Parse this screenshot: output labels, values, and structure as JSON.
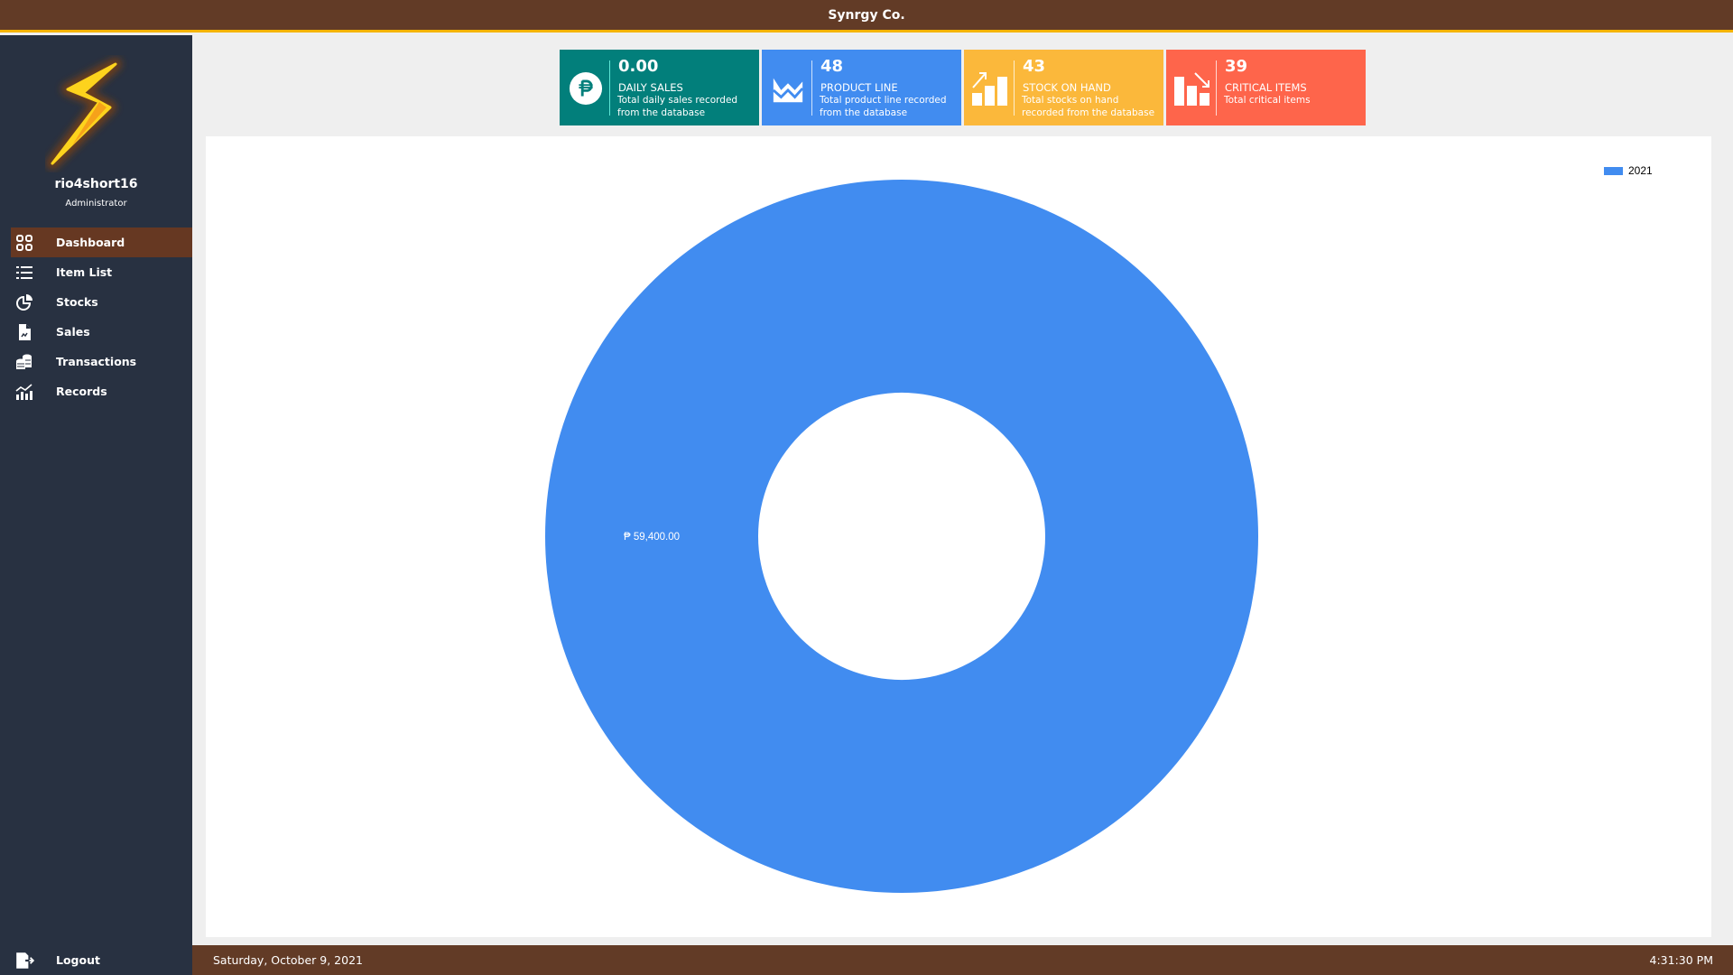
{
  "app": {
    "title": "Synrgy Co."
  },
  "user": {
    "name": "rio4short16",
    "role": "Administrator"
  },
  "sidebar": {
    "items": [
      {
        "label": "Dashboard",
        "icon": "grid-icon",
        "active": true
      },
      {
        "label": "Item List",
        "icon": "list-icon",
        "active": false
      },
      {
        "label": "Stocks",
        "icon": "pie-chart-icon",
        "active": false
      },
      {
        "label": "Sales",
        "icon": "document-chart-icon",
        "active": false
      },
      {
        "label": "Transactions",
        "icon": "coins-icon",
        "active": false
      },
      {
        "label": "Records",
        "icon": "bar-trend-icon",
        "active": false
      }
    ],
    "logout_label": "Logout"
  },
  "cards": [
    {
      "value": "0.00",
      "label": "DAILY SALES",
      "desc": "Total daily sales recorded from the database",
      "icon": "peso-icon",
      "color": "#027f7b"
    },
    {
      "value": "48",
      "label": "PRODUCT LINE",
      "desc": "Total product line recorded from the database",
      "icon": "area-chart-icon",
      "color": "#418cf0"
    },
    {
      "value": "43",
      "label": "STOCK ON HAND",
      "desc": "Total stocks on hand recorded from the database",
      "icon": "bar-chart-up-icon",
      "color": "#fbb83b"
    },
    {
      "value": "39",
      "label": "CRITICAL ITEMS",
      "desc": "Total critical items",
      "icon": "bar-chart-down-icon",
      "color": "#fe654b"
    }
  ],
  "chart_data": {
    "type": "pie",
    "variant": "doughnut",
    "title": "",
    "categories": [
      "2021"
    ],
    "values": [
      59400.0
    ],
    "value_labels": [
      "₱ 59,400.00"
    ],
    "colors": [
      "#418cf0"
    ],
    "legend": {
      "entries": [
        "2021"
      ],
      "placement": "top-right"
    }
  },
  "status": {
    "date": "Saturday, October 9, 2021",
    "time": "4:31:30 PM"
  }
}
